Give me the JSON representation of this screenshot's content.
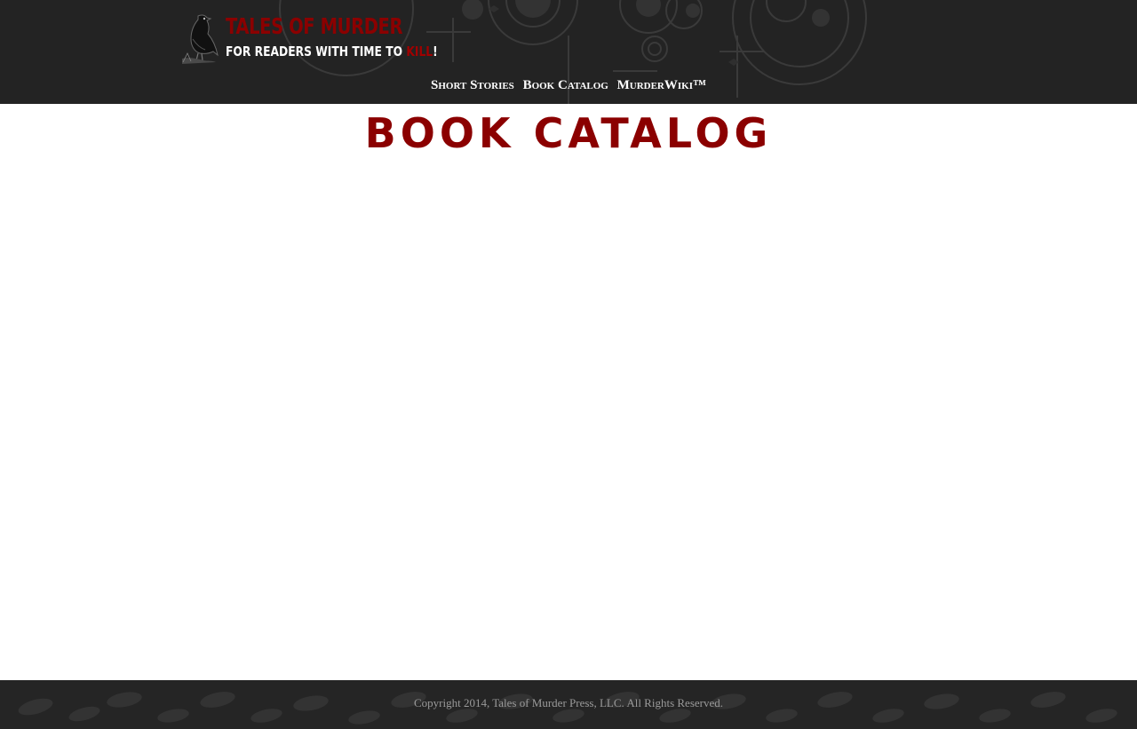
{
  "header": {
    "logo": {
      "title": "TALES OF MURDER",
      "tagline_prefix": "FOR READERS WITH TIME TO ",
      "tagline_highlight": "KILL",
      "tagline_suffix": "!"
    },
    "nav": {
      "items": [
        {
          "label": "Short Stories"
        },
        {
          "label": "Book Catalog"
        },
        {
          "label": "MurderWiki™"
        }
      ]
    }
  },
  "main": {
    "title": "BOOK CATALOG"
  },
  "footer": {
    "copyright": "Copyright 2014, Tales of Murder Press, LLC. All Rights Reserved."
  },
  "colors": {
    "header_bg": "#232323",
    "accent": "#8b0000",
    "footer_bg": "#252525",
    "footer_text": "#9a9a9a"
  },
  "icons": {
    "logo": "raven-icon"
  }
}
